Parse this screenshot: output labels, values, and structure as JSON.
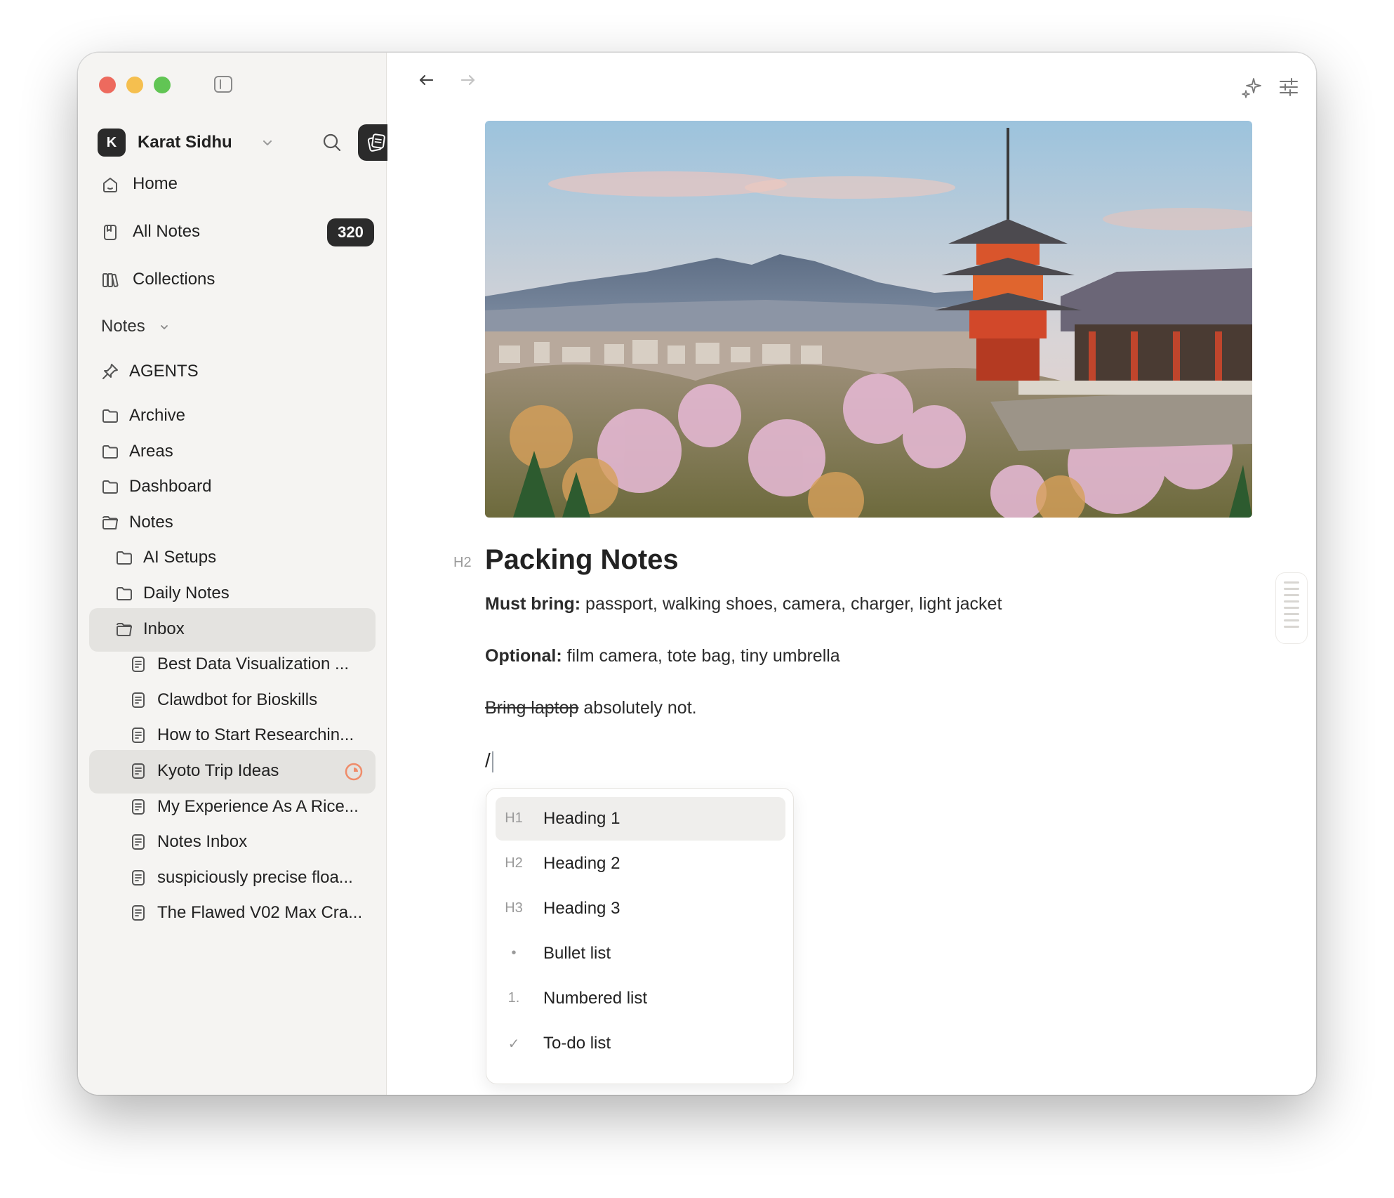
{
  "window": {
    "traffic_lights": [
      "close",
      "minimize",
      "zoom"
    ]
  },
  "account": {
    "initial": "K",
    "name": "Karat Sidhu"
  },
  "sidebar": {
    "nav": [
      {
        "label": "Home",
        "icon": "home-icon"
      },
      {
        "label": "All Notes",
        "icon": "notes-icon",
        "badge": "320"
      },
      {
        "label": "Collections",
        "icon": "collections-icon"
      }
    ],
    "notes_section_label": "Notes",
    "pinned": {
      "label": "AGENTS",
      "icon": "pin-icon"
    },
    "tree": [
      {
        "label": "Archive",
        "level": 0,
        "type": "folder"
      },
      {
        "label": "Areas",
        "level": 0,
        "type": "folder"
      },
      {
        "label": "Dashboard",
        "level": 0,
        "type": "folder"
      },
      {
        "label": "Notes",
        "level": 0,
        "type": "folder-open"
      },
      {
        "label": "AI Setups",
        "level": 1,
        "type": "folder"
      },
      {
        "label": "Daily Notes",
        "level": 1,
        "type": "folder"
      },
      {
        "label": "Inbox",
        "level": 1,
        "type": "folder-open",
        "selected": true
      },
      {
        "label": "Best Data Visualization ...",
        "level": 2,
        "type": "note"
      },
      {
        "label": "Clawdbot for Bioskills",
        "level": 2,
        "type": "note"
      },
      {
        "label": "How to Start Researchin...",
        "level": 2,
        "type": "note"
      },
      {
        "label": "Kyoto Trip Ideas",
        "level": 2,
        "type": "note",
        "selected": true,
        "status": "in-progress"
      },
      {
        "label": "My Experience As A Rice...",
        "level": 2,
        "type": "note"
      },
      {
        "label": "Notes Inbox",
        "level": 2,
        "type": "note"
      },
      {
        "label": "suspiciously precise floa...",
        "level": 2,
        "type": "note"
      },
      {
        "label": "The Flawed V02 Max Cra...",
        "level": 2,
        "type": "note"
      }
    ]
  },
  "editor": {
    "heading_marker": "H2",
    "title": "Packing Notes",
    "must_bring_label": "Must bring:",
    "must_bring_text": " passport, walking shoes, camera, charger, light jacket",
    "optional_label": "Optional:",
    "optional_text": " film camera, tote bag, tiny umbrella",
    "struck_text": "Bring laptop",
    "after_struck_text": " absolutely not.",
    "slash_input": "/"
  },
  "slash_menu": {
    "items": [
      {
        "key": "H1",
        "label": "Heading 1",
        "active": true
      },
      {
        "key": "H2",
        "label": "Heading 2"
      },
      {
        "key": "H3",
        "label": "Heading 3"
      },
      {
        "key": "•",
        "label": "Bullet list"
      },
      {
        "key": "1.",
        "label": "Numbered list"
      },
      {
        "key": "✓",
        "label": "To-do list"
      }
    ]
  },
  "colors": {
    "sidebar_bg": "#f5f4f2",
    "selected_bg": "#e4e3e0",
    "badge_bg": "#2b2b2b",
    "status_accent": "#ef8c6a"
  }
}
